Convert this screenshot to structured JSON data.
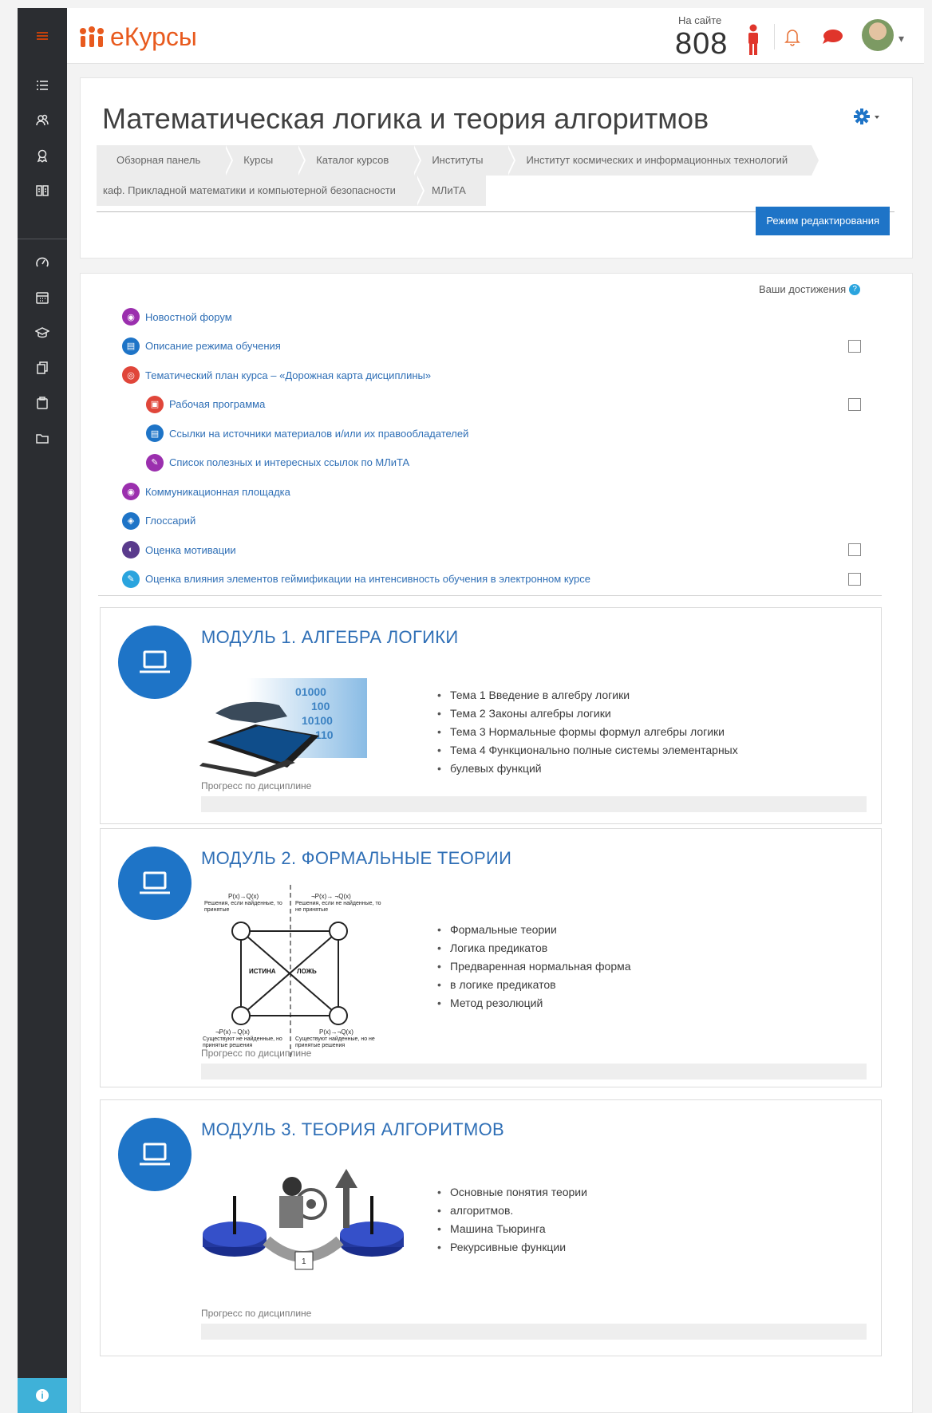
{
  "brand": {
    "name": "еКурсы"
  },
  "online": {
    "label": "На сайте",
    "count": "808"
  },
  "header": {
    "title": "Математическая логика и теория алгоритмов",
    "breadcrumbs_row1": [
      "Обзорная панель",
      "Курсы",
      "Каталог курсов",
      "Институты",
      "Институт космических и информационных технологий"
    ],
    "breadcrumbs_row2": [
      "каф. Прикладной математики и компьютерной безопасности",
      "МЛиТА"
    ],
    "edit_button": "Режим редактирования"
  },
  "achievements": {
    "label": "Ваши достижения",
    "help": "?"
  },
  "activities": [
    {
      "label": "Новостной форум",
      "icon": "forum-icon",
      "color": "#9b2fae",
      "indent": false,
      "checkbox": false
    },
    {
      "label": "Описание режима обучения",
      "icon": "page-icon",
      "color": "#1e74c7",
      "indent": false,
      "checkbox": true
    },
    {
      "label": "Тематический план курса – «Дорожная карта дисциплины»",
      "icon": "book-icon",
      "color": "#e0463a",
      "indent": false,
      "checkbox": false
    },
    {
      "label": "Рабочая программа",
      "icon": "pdf-icon",
      "color": "#e0463a",
      "indent": true,
      "checkbox": true
    },
    {
      "label": "Ссылки на источники материалов и/или их правообладателей",
      "icon": "page-icon",
      "color": "#1e74c7",
      "indent": true,
      "checkbox": false
    },
    {
      "label": "Список полезных и интересных ссылок по МЛиТА",
      "icon": "link-icon",
      "color": "#9b2fae",
      "indent": true,
      "checkbox": false
    },
    {
      "label": "Коммуникационная площадка",
      "icon": "forum-icon",
      "color": "#9b2fae",
      "indent": false,
      "checkbox": false
    },
    {
      "label": "Глоссарий",
      "icon": "glossary-icon",
      "color": "#1e74c7",
      "indent": false,
      "checkbox": false
    },
    {
      "label": "Оценка мотивации",
      "icon": "feedback-icon",
      "color": "#5a3b8c",
      "indent": false,
      "checkbox": true
    },
    {
      "label": "Оценка влияния элементов геймификации на интенсивность обучения в электронном курсе",
      "icon": "link-icon",
      "color": "#2aa4de",
      "indent": false,
      "checkbox": true
    }
  ],
  "modules": [
    {
      "title": "МОДУЛЬ 1. АЛГЕБРА ЛОГИКИ",
      "topics": [
        "Тема 1 Введение в алгебру логики",
        "Тема 2 Законы алгебры логики",
        "Тема 3 Нормальные формы формул алгебры логики",
        "Тема 4 Функционально полные системы элементарных",
        "булевых функций"
      ],
      "progress_label": "Прогресс по дисциплине",
      "progress": 0.0
    },
    {
      "title": "МОДУЛЬ 2. ФОРМАЛЬНЫЕ ТЕОРИИ",
      "topics": [
        "Формальные теории",
        "Логика предикатов",
        "Предваренная нормальная форма",
        "в логике предикатов",
        "Метод резолюций"
      ],
      "progress_label": "Прогресс по дисциплине",
      "progress": 0.0,
      "diagram": {
        "top_left": "P(x)→Q(x)",
        "top_left_note": "Решения, если найденные, то принятые",
        "top_right": "¬P(x)→ ¬Q(x)",
        "top_right_note": "Решения, если не найденные, то не принятые",
        "center_left": "ИСТИНА",
        "center_right": "ЛОЖЬ",
        "bottom_left": "¬P(x)→Q(x)",
        "bottom_left_note": "Существуют не найденные, но принятые решения",
        "bottom_right": "P(x)→¬Q(x)",
        "bottom_right_note": "Существуют найденные, но не принятые решения"
      }
    },
    {
      "title": "МОДУЛЬ 3. ТЕОРИЯ АЛГОРИТМОВ",
      "topics": [
        "Основные понятия теории",
        "алгоритмов.",
        "Машина Тьюринга",
        "Рекурсивные функции"
      ],
      "progress_label": "Прогресс по дисциплине",
      "progress": 0.0
    }
  ],
  "colors": {
    "accent": "#1e74c7",
    "brand": "#e85a1e",
    "sidebar": "#2b2d31",
    "info": "#3fb1d8"
  }
}
